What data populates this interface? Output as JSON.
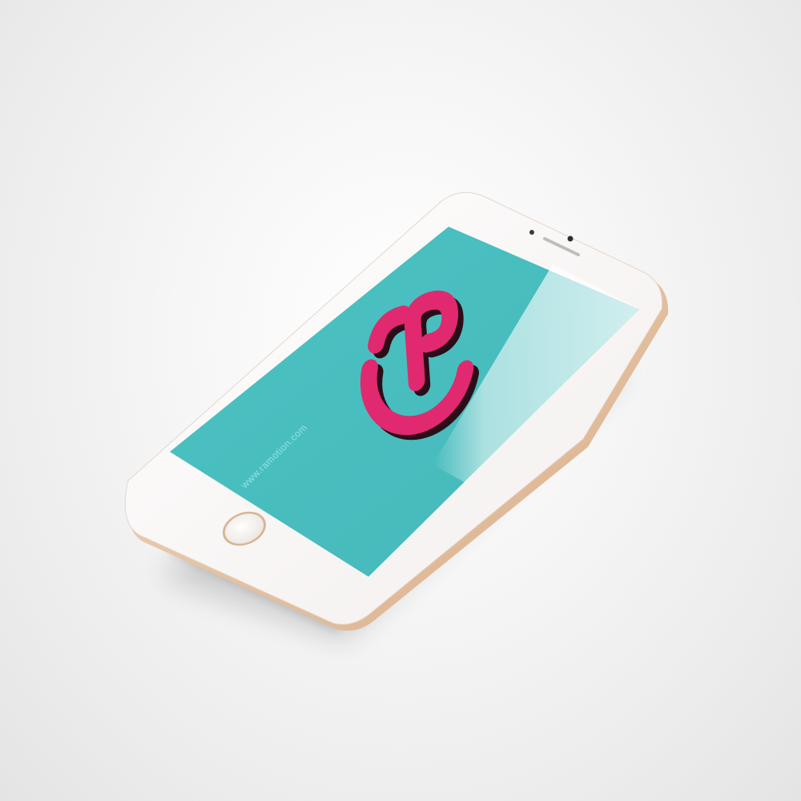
{
  "photo": {
    "subject": "smartphone",
    "screen": {
      "url_text": "www.ramotion.com"
    }
  },
  "colors": {
    "background": "#ededed",
    "phone_body_gold": "#e8c9ad",
    "phone_face_white": "#faf8f7",
    "screen_teal": "#4bbfc1",
    "logo_pink": "#e0296e",
    "logo_shadow": "#2b0d17",
    "url_text": "#8fe3e4"
  },
  "icons": {
    "logo": "cp-logo",
    "home_button": "home-button-ring"
  }
}
